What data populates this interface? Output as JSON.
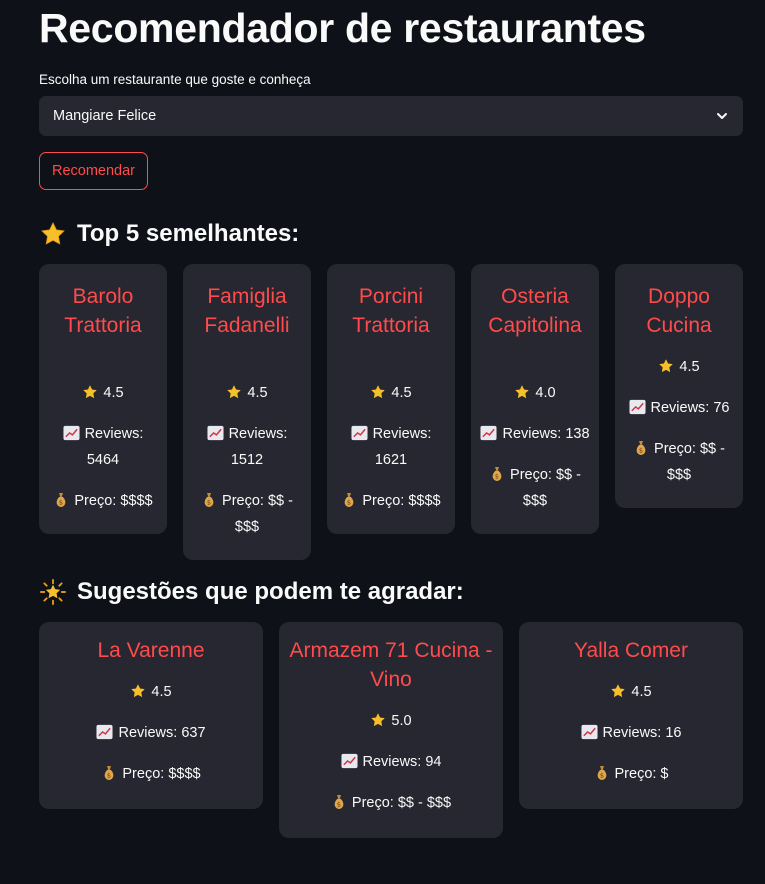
{
  "page": {
    "title": "Recomendador de restaurantes"
  },
  "selector": {
    "label": "Escolha um restaurante que goste e conheça",
    "selected": "Mangiare Felice"
  },
  "recommend_button": {
    "label": "Recomendar"
  },
  "similar": {
    "heading": "Top 5 semelhantes:",
    "heading_icon": "star-icon",
    "cards": [
      {
        "name": "Barolo Trattoria",
        "rating": "4.5",
        "reviews": "Reviews: 5464",
        "price": "Preço: $$$$"
      },
      {
        "name": "Famiglia Fadanelli",
        "rating": "4.5",
        "reviews": "Reviews: 1512",
        "price": "Preço: $$ - $$$"
      },
      {
        "name": "Porcini Trattoria",
        "rating": "4.5",
        "reviews": "Reviews: 1621",
        "price": "Preço: $$$$"
      },
      {
        "name": "Osteria Capitolina",
        "rating": "4.0",
        "reviews": "Reviews: 138",
        "price": "Preço: $$ - $$$"
      },
      {
        "name": "Doppo Cucina",
        "rating": "4.5",
        "reviews": "Reviews: 76",
        "price": "Preço: $$ - $$$"
      }
    ]
  },
  "suggestions": {
    "heading": "Sugestões que podem te agradar:",
    "heading_icon": "glowing-star-icon",
    "cards": [
      {
        "name": "La Varenne",
        "rating": "4.5",
        "reviews": "Reviews: 637",
        "price": "Preço: $$$$"
      },
      {
        "name": "Armazem 71 Cucina - Vino",
        "rating": "5.0",
        "reviews": "Reviews: 94",
        "price": "Preço: $$ - $$$"
      },
      {
        "name": "Yalla Comer",
        "rating": "4.5",
        "reviews": "Reviews: 16",
        "price": "Preço: $"
      }
    ]
  },
  "colors": {
    "background": "#0e1117",
    "surface": "#262730",
    "accent": "#ff4b4b",
    "text": "#fafafa"
  }
}
